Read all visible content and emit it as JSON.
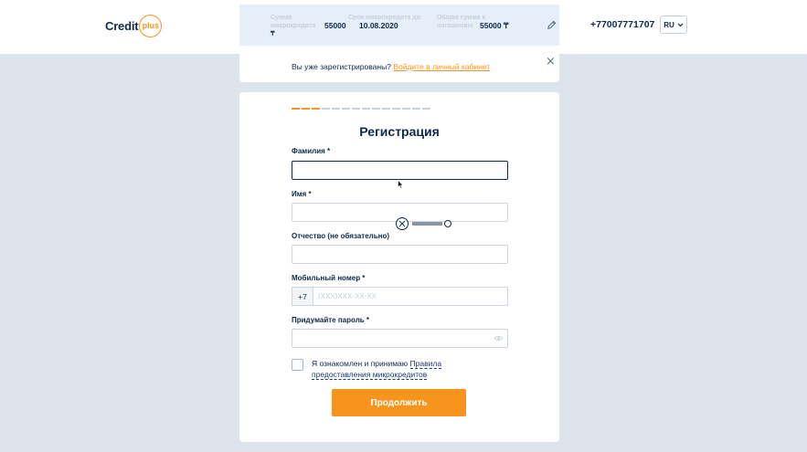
{
  "header": {
    "logo_text": "Credit",
    "logo_badge": "plus",
    "summary": {
      "amount_label": "Сумма микрокредита",
      "amount_value": "55000",
      "amount_currency": "₸",
      "term_label": "Срок микрокредита до",
      "term_value": "10.08.2020",
      "total_label": "Общая сумма к погашению",
      "total_value": "55000",
      "total_currency": "₸"
    },
    "phone": "+77007771707",
    "language": "RU"
  },
  "notice": {
    "text": "Вы уже зарегистрированы?",
    "link": "Войдите в личный кабинет",
    "close": "×"
  },
  "form": {
    "title": "Регистрация",
    "progress": {
      "total_steps": 14,
      "completed_steps": 3
    },
    "fields": {
      "last_name": {
        "label": "Фамилия *",
        "value": ""
      },
      "first_name": {
        "label": "Имя *",
        "value": ""
      },
      "middle_name": {
        "label": "Отчество (не обязательно)",
        "value": ""
      },
      "mobile": {
        "label": "Мобильный номер *",
        "prefix": "+7",
        "placeholder": "(XXX)XXX-XX-XX",
        "value": ""
      },
      "password": {
        "label": "Придумайте пароль *",
        "value": ""
      }
    },
    "agreement": {
      "text": "Я ознакомлен и принимаю",
      "link": "Правила предоставления микрокредитов",
      "checked": false
    },
    "submit_label": "Продолжить"
  },
  "colors": {
    "accent": "#f7941d",
    "brand_dark": "#0d2a4a",
    "background": "#dde4ec",
    "link": "#1b3a7a"
  }
}
